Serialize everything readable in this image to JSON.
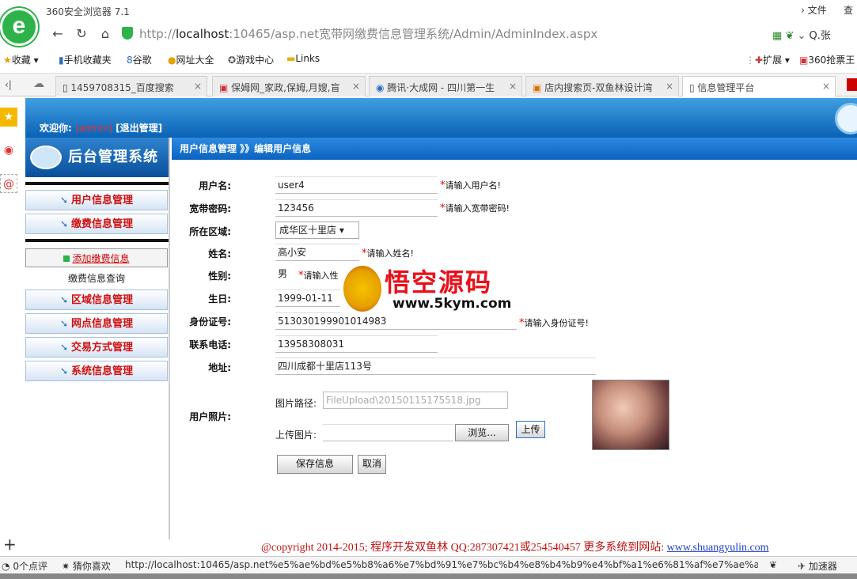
{
  "browser": {
    "title": "360安全浏览器 7.1",
    "menu_file": "文件",
    "menu_view": "查",
    "logo_letter": "e",
    "address_prefix": "http://",
    "address_host": "localhost",
    "address_rest": ":10465/asp.net宽带网缴费信息管理系统/Admin/AdminIndex.aspx",
    "search_label": "Q.张"
  },
  "bookmarks": [
    "收藏",
    "手机收藏夹",
    "谷歌",
    "网址大全",
    "游戏中心",
    "Links",
    "扩展",
    "360抢票王"
  ],
  "tabs": [
    {
      "label": "1459708315_百度搜索",
      "active": false
    },
    {
      "label": "保姆网_家政,保姆,月嫂,盲",
      "active": false
    },
    {
      "label": "腾讯·大成网 - 四川第一生",
      "active": false
    },
    {
      "label": "店内搜索页-双鱼林设计湾",
      "active": false
    },
    {
      "label": "信息管理平台",
      "active": true
    }
  ],
  "header": {
    "welcome": "欢迎你:",
    "user": "[admin]",
    "logout": "[退出管理]"
  },
  "menu": {
    "title": "后台管理系统",
    "user_mgmt": "用户信息管理",
    "fee_mgmt": "缴费信息管理",
    "add_fee": "添加缴费信息",
    "fee_query": "缴费信息查询",
    "area_mgmt": "区域信息管理",
    "site_mgmt": "网点信息管理",
    "trade_mgmt": "交易方式管理",
    "system_mgmt": "系统信息管理"
  },
  "breadcrumb": "用户信息管理 》》编辑用户信息",
  "form": {
    "username_label": "用户名:",
    "username": "user4",
    "username_hint": "请输入用户名!",
    "password_label": "宽带密码:",
    "password": "123456",
    "password_hint": "请输入宽带密码!",
    "area_label": "所在区域:",
    "area": "成华区十里店",
    "name_label": "姓名:",
    "name": "高小安",
    "name_hint": "请输入姓名!",
    "gender_label": "性别:",
    "gender": "男",
    "gender_hint": "请输入性",
    "birthday_label": "生日:",
    "birthday": "1999-01-11",
    "idcard_label": "身份证号:",
    "idcard": "513030199901014983",
    "idcard_hint": "请输入身份证号!",
    "phone_label": "联系电话:",
    "phone": "13958308031",
    "address_label": "地址:",
    "address": "四川成都十里店113号",
    "photo_label": "用户照片:",
    "photo_path_label": "图片路径:",
    "photo_path": "FileUpload\\20150115175518.jpg",
    "upload_label": "上传图片:",
    "browse_btn": "浏览...",
    "upload_btn": "上传",
    "save_btn": "保存信息",
    "cancel_btn": "取消"
  },
  "watermark": {
    "title": "悟空源码",
    "url": "www.5kym.com"
  },
  "footer": {
    "copyright": "@copyright 2014-2015; 程序开发双鱼林  QQ:287307421或254540457  更多系统到网站: ",
    "link": "www.shuangyulin.com"
  },
  "status": {
    "reviews": "0个点评",
    "guess": "猜你喜欢",
    "url": "http://localhost:10465/asp.net%e5%ae%bd%e5%b8%a6%e7%bd%91%e7%bc%b4%e8%b4%b9%e4%bf%a1%e6%81%af%e7%ae%a1%e7%",
    "accelerator": "加速器"
  },
  "colors": {
    "header_blue": "#0b62b5",
    "menu_red": "#d01010",
    "brand_green": "#2db34a"
  }
}
